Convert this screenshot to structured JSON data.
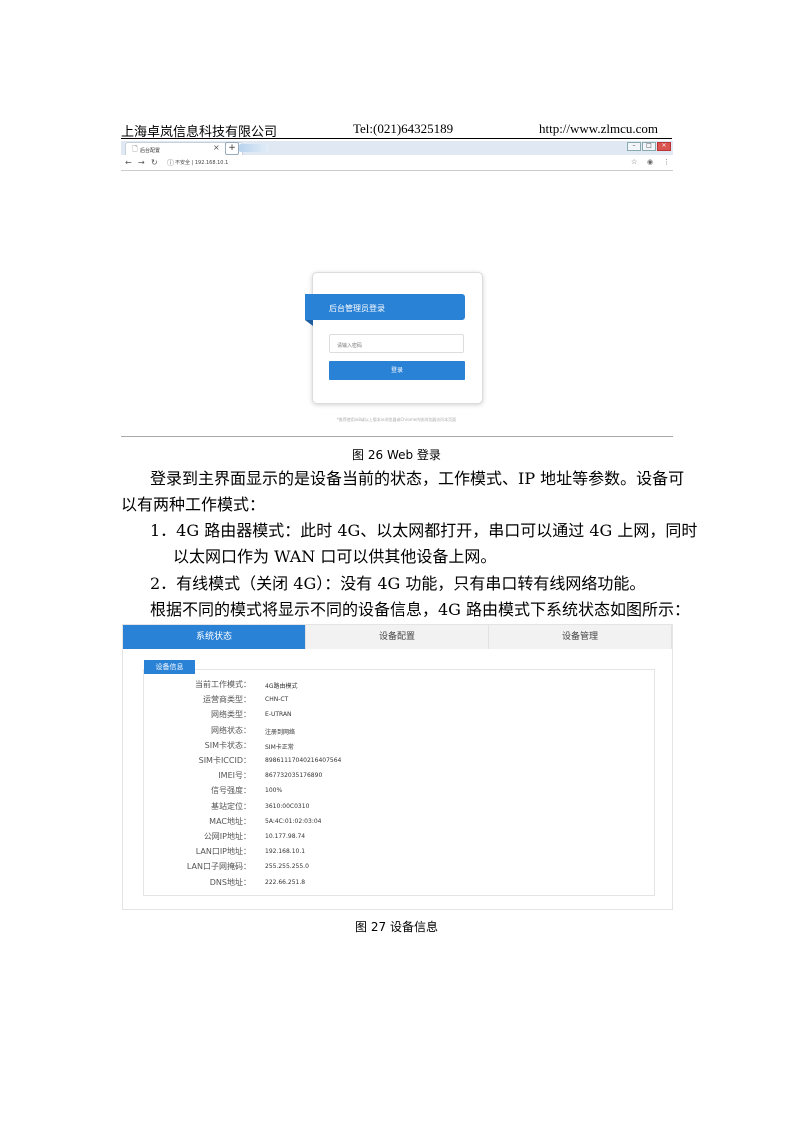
{
  "header": {
    "company": "上海卓岚信息科技有限公司",
    "tel": "Tel:(021)64325189",
    "url": "http://www.zlmcu.com"
  },
  "browser": {
    "tab_title": "后台配置",
    "tab_close": "×",
    "new_tab": "+",
    "address": "不安全 | 192.168.10.1"
  },
  "login": {
    "title": "后台管理员登录",
    "password_placeholder": "请输入密码",
    "button": "登录",
    "note": "*推荐使用ie8或以上版本ie浏览器或Chrome内核浏览器访问本页面"
  },
  "figure1_caption": "图 26 Web 登录",
  "body": {
    "p1_line1": "登录到主界面显示的是设备当前的状态，工作模式、IP 地址等参数。设备可",
    "p1_line2": "以有两种工作模式：",
    "item1_line1": "1．4G 路由器模式：此时 4G、以太网都打开，串口可以通过 4G 上网，同时",
    "item1_line2": "以太网口作为 WAN 口可以供其他设备上网。",
    "item2": "2．有线模式（关闭 4G）：没有 4G 功能，只有串口转有线网络功能。",
    "p2": "根据不同的模式将显示不同的设备信息，4G 路由模式下系统状态如图所示："
  },
  "device": {
    "tabs": [
      "系统状态",
      "设备配置",
      "设备管理"
    ],
    "legend": "设备信息",
    "rows": [
      {
        "label": "当前工作模式：",
        "value": "4G路由模式"
      },
      {
        "label": "运营商类型：",
        "value": "CHN-CT"
      },
      {
        "label": "网络类型：",
        "value": "E-UTRAN"
      },
      {
        "label": "网络状态：",
        "value": "注册到网络"
      },
      {
        "label": "SIM卡状态：",
        "value": "SIM卡正常"
      },
      {
        "label": "SIM卡ICCID：",
        "value": "89861117040216407564"
      },
      {
        "label": "IMEI号：",
        "value": "867732035176890"
      },
      {
        "label": "信号强度：",
        "value": "100%"
      },
      {
        "label": "基站定位：",
        "value": "3610:00C0310"
      },
      {
        "label": "MAC地址：",
        "value": "5A:4C:01:02:03:04"
      },
      {
        "label": "公网IP地址：",
        "value": "10.177.98.74"
      },
      {
        "label": "LAN口IP地址：",
        "value": "192.168.10.1"
      },
      {
        "label": "LAN口子网掩码：",
        "value": "255.255.255.0"
      },
      {
        "label": "DNS地址：",
        "value": "222.66.251.8"
      }
    ]
  },
  "figure2_caption": "图 27 设备信息"
}
